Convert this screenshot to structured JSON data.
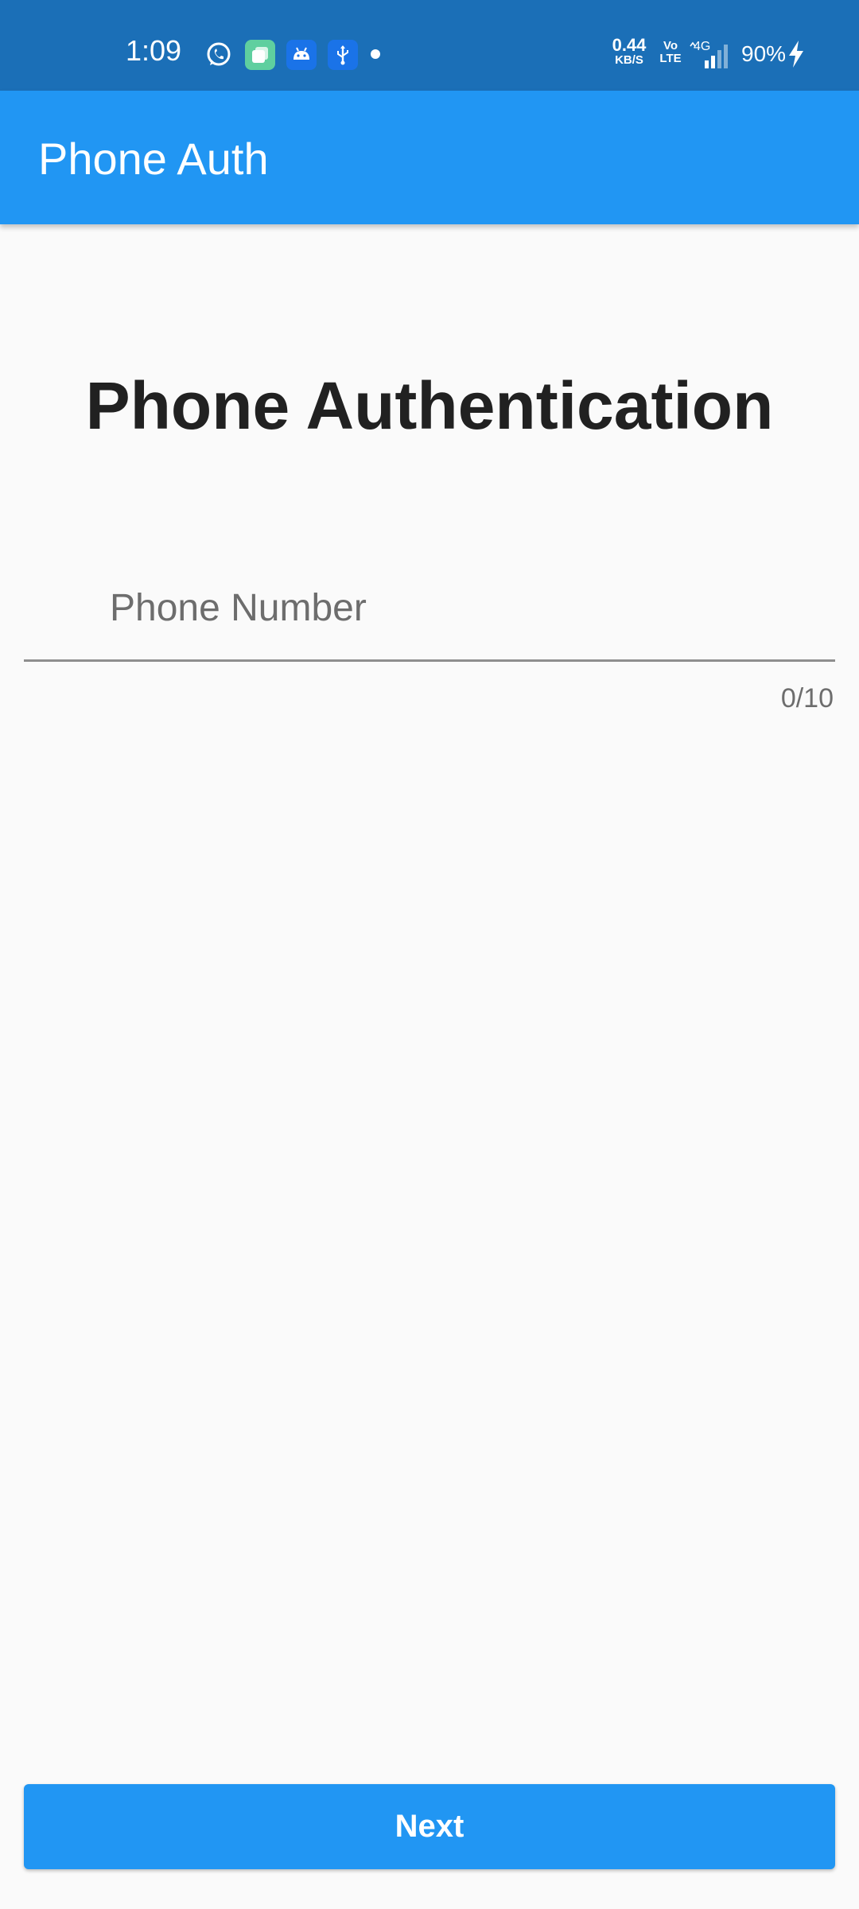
{
  "status_bar": {
    "time": "1:09",
    "net_speed_value": "0.44",
    "net_speed_unit": "KB/S",
    "volte_top": "Vo",
    "volte_bottom": "LTE",
    "network_type": "4G",
    "battery": "90%",
    "notification_icons": [
      "whatsapp-icon",
      "gallery-app-icon",
      "android-debug-icon",
      "usb-icon"
    ]
  },
  "app_bar": {
    "title": "Phone Auth"
  },
  "main": {
    "heading": "Phone Authentication",
    "phone_field": {
      "placeholder": "Phone Number",
      "value": "",
      "counter": "0/10"
    },
    "next_button": {
      "label": "Next"
    }
  },
  "colors": {
    "status_bar": "#1b6fb7",
    "primary": "#2196f3",
    "background": "#fafafa",
    "heading_text": "#212121",
    "hint_text": "#6d6d6d"
  }
}
